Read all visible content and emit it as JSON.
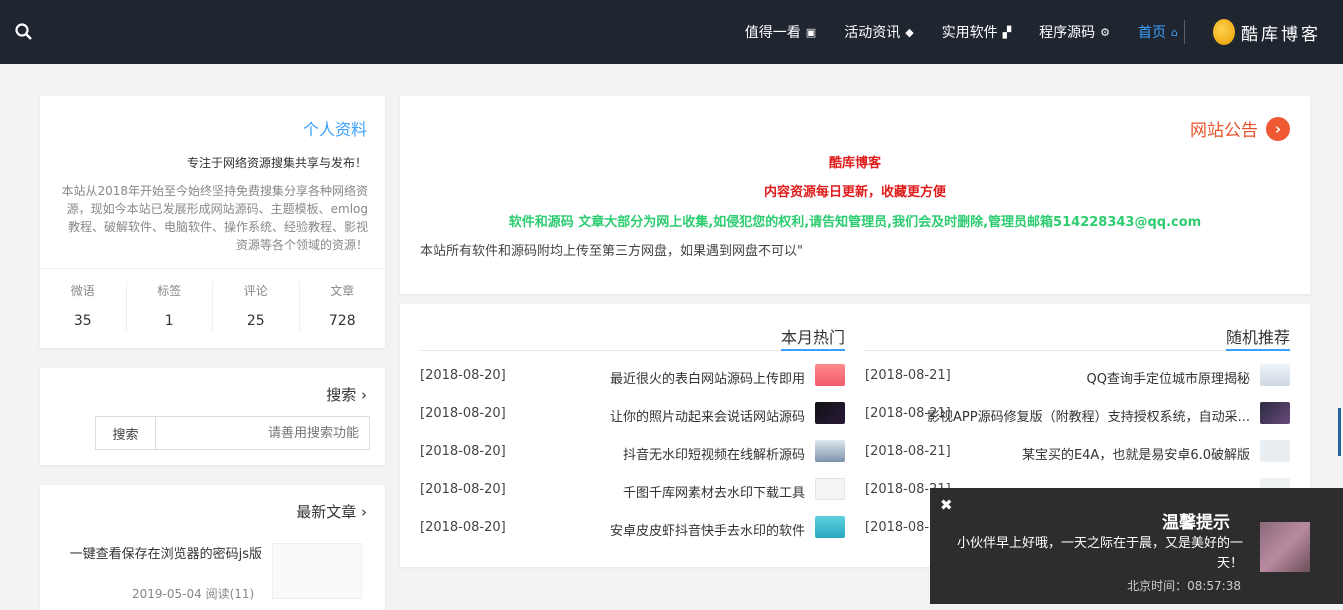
{
  "nav": {
    "logo_text": "酷库博客",
    "items": [
      {
        "label": "首页",
        "icon": "home-icon"
      },
      {
        "label": "程序源码",
        "icon": "gear-icon"
      },
      {
        "label": "实用软件",
        "icon": "puzzle-icon"
      },
      {
        "label": "活动资讯",
        "icon": "tag-icon"
      },
      {
        "label": "值得一看",
        "icon": "image-icon"
      }
    ],
    "search_icon": "search-icon"
  },
  "notice": {
    "title": "网站公告",
    "line1": "酷库博客",
    "line2": "内容资源每日更新，收藏更方便",
    "line3": "软件和源码 文章大部分为网上收集,如侵犯您的权利,请告知管理员,我们会及时删除,管理员邮箱514228343@qq.com",
    "line4": "本站所有软件和源码附均上传至第三方网盘，如果遇到网盘不可以\""
  },
  "hot": {
    "left_title": "随机推荐",
    "right_title": "本月热门",
    "left_posts": [
      {
        "title": "QQ查询手定位城市原理揭秘",
        "date": "[2018-08-21]"
      },
      {
        "title": "影视APP源码修复版（附教程）支持授权系统，自动采...",
        "date": "[2018-08-21]"
      },
      {
        "title": "某宝买的E4A，也就是易安卓6.0破解版",
        "date": "[2018-08-21]"
      },
      {
        "title": "",
        "date": "[2018-08-21]"
      },
      {
        "title": "",
        "date": "[2018-08-21]"
      }
    ],
    "right_posts": [
      {
        "title": "最近很火的表白网站源码上传即用",
        "date": "[2018-08-20]"
      },
      {
        "title": "让你的照片动起来会说话网站源码",
        "date": "[2018-08-20]"
      },
      {
        "title": "抖音无水印短视频在线解析源码",
        "date": "[2018-08-20]"
      },
      {
        "title": "千图千库网素材去水印下载工具",
        "date": "[2018-08-20]"
      },
      {
        "title": "安卓皮皮虾抖音快手去水印的软件",
        "date": "[2018-08-20]"
      }
    ]
  },
  "profile": {
    "title": "个人资料",
    "motto": "专注于网络资源搜集共享与发布！",
    "description": "本站从2018年开始至今始终坚持免费搜集分享各种网络资源，现如今本站已发展形成网站源码、主题模板、emlog教程、破解软件、电脑软件、操作系统、经验教程、影视资源等各个领域的资源！",
    "stats": [
      {
        "label": "文章",
        "value": "728"
      },
      {
        "label": "评论",
        "value": "25"
      },
      {
        "label": "标签",
        "value": "1"
      },
      {
        "label": "微语",
        "value": "35"
      }
    ]
  },
  "search": {
    "title": "搜索",
    "placeholder": "请善用搜索功能",
    "button": "搜索"
  },
  "latest": {
    "title": "最新文章",
    "post_title": "一键查看保存在浏览器的密码js版",
    "post_date": "2019-05-04",
    "post_reads": "阅读(11)"
  },
  "popup": {
    "title": "温馨提示",
    "body": "小伙伴早上好哦，一天之际在于晨，又是美好的一天！",
    "time_label": "北京时间：",
    "time": "08:57:38",
    "close": "✖"
  }
}
